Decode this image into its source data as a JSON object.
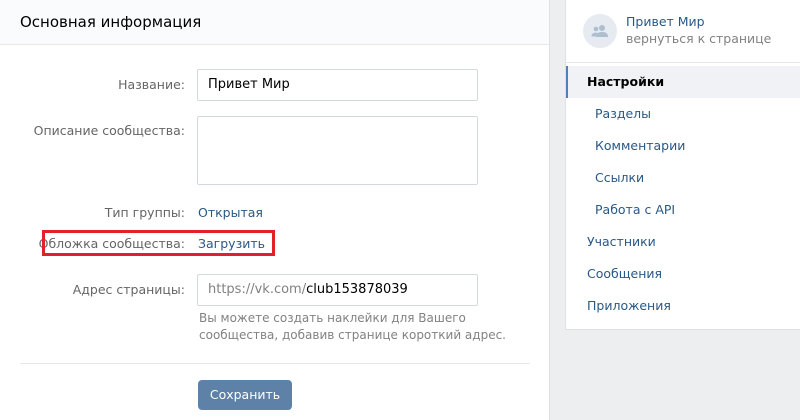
{
  "main": {
    "title": "Основная информация",
    "name_label": "Название:",
    "name_value": "Привет Мир",
    "description_label": "Описание сообщества:",
    "group_type_label": "Тип группы:",
    "group_type_value": "Открытая",
    "cover_label": "Обложка сообщества:",
    "cover_link": "Загрузить",
    "address_label": "Адрес страницы:",
    "address_prefix": "https://vk.com/",
    "address_value": "club153878039",
    "address_hint": "Вы можете создать наклейки для Вашего сообщества, добавив странице короткий адрес.",
    "save_label": "Сохранить"
  },
  "sidebar": {
    "group_name": "Привет Мир",
    "group_back": "вернуться к странице",
    "items": [
      {
        "label": "Настройки"
      },
      {
        "label": "Разделы"
      },
      {
        "label": "Комментарии"
      },
      {
        "label": "Ссылки"
      },
      {
        "label": "Работа с API"
      },
      {
        "label": "Участники"
      },
      {
        "label": "Сообщения"
      },
      {
        "label": "Приложения"
      }
    ]
  },
  "colors": {
    "accent": "#5181b8",
    "link": "#2a5885",
    "highlight": "#e0202b"
  }
}
